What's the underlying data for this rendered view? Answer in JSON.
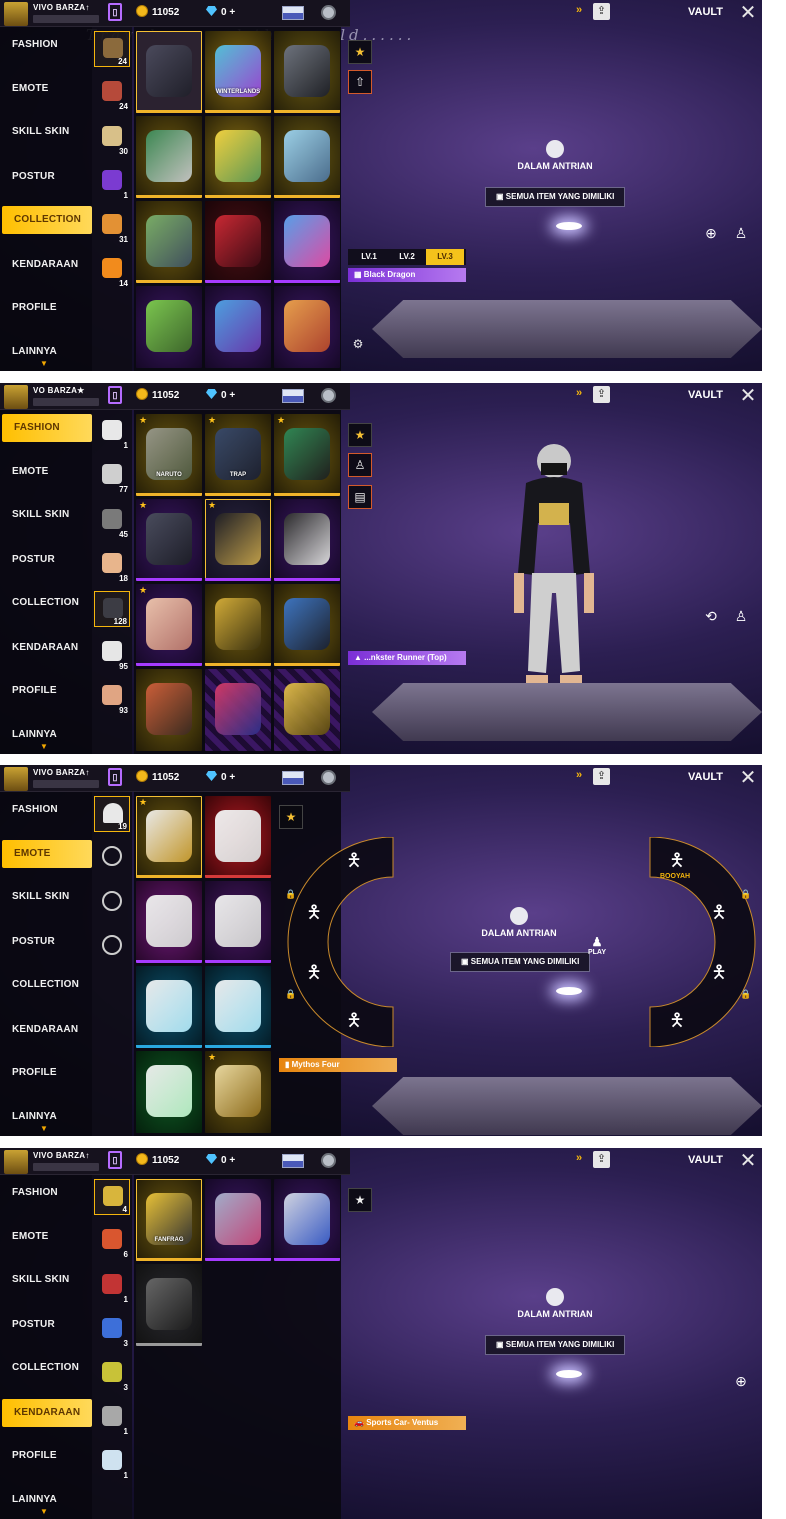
{
  "common": {
    "gold": "11052",
    "diamonds": "0 +",
    "vault": "VAULT",
    "fast_forward": "»",
    "nav": [
      "FASHION",
      "EMOTE",
      "SKILL SKIN",
      "POSTUR",
      "COLLECTION",
      "KENDARAAN",
      "PROFILE",
      "LAINNYA"
    ]
  },
  "panels": [
    {
      "player_name": "VIVO  BARZA↑",
      "active_nav": "COLLECTION",
      "watermark": "Travel around the world......",
      "subcategory_counts": [
        "24",
        "24",
        "30",
        "1",
        "31",
        "14"
      ],
      "item_text": [
        "WINTERLANDS"
      ],
      "levels": [
        "LV.1",
        "LV.2",
        "LV.3"
      ],
      "selected_item": "Black Dragon",
      "queue_label": "DALAM ANTRIAN",
      "owned_label": "SEMUA ITEM YANG DIMILIKI"
    },
    {
      "player_name": "VO  BARZA★",
      "active_nav": "FASHION",
      "subcategory_counts": [
        "1",
        "77",
        "45",
        "18",
        "128",
        "95",
        "93"
      ],
      "item_text": [
        "NARUTO",
        "ТRAP"
      ],
      "selected_item": "...nkster Runner (Top)"
    },
    {
      "player_name": "VIVO  BARZA↑",
      "active_nav": "EMOTE",
      "subcategory_counts": [
        "19"
      ],
      "queue_label": "DALAM ANTRIAN",
      "owned_label": "SEMUA ITEM YANG DIMILIKI",
      "play_label": "PLAY",
      "wheel_label": "BOOYAH",
      "selected_item": "Mythos Four"
    },
    {
      "player_name": "VIVO  BARZA↑",
      "active_nav": "KENDARAAN",
      "subcategory_counts": [
        "4",
        "6",
        "1",
        "3",
        "3",
        "1",
        "1"
      ],
      "item_text": [
        "FANFRAG"
      ],
      "queue_label": "DALAM ANTRIAN",
      "owned_label": "SEMUA ITEM YANG DIMILIKI",
      "selected_item": "Sports Car- Ventus"
    }
  ],
  "colors": {
    "accent": "#ffbf00",
    "selected_chip": "#8a3ee0",
    "vehicle_chip": "#e7850f"
  }
}
